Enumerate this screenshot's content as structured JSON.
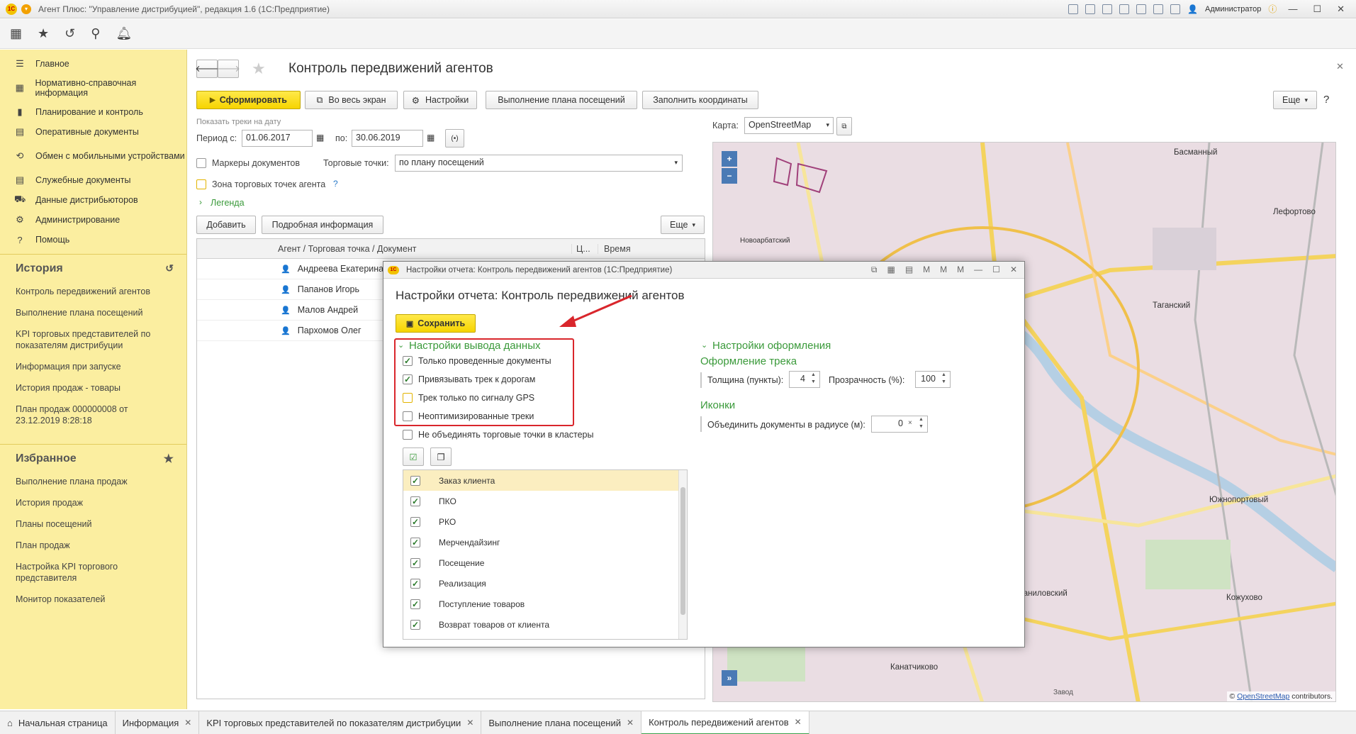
{
  "window": {
    "title": "Агент Плюс: \"Управление дистрибуцией\", редакция 1.6  (1С:Предприятие)",
    "user": "Администратор"
  },
  "sidebar": {
    "nav": [
      {
        "icon": "menu-icon",
        "label": "Главное"
      },
      {
        "icon": "catalog-icon",
        "label": "Нормативно-справочная информация"
      },
      {
        "icon": "chart-icon",
        "label": "Планирование и контроль"
      },
      {
        "icon": "docs-icon",
        "label": "Оперативные документы"
      },
      {
        "icon": "sync-icon",
        "label": "Обмен с мобильными устройствами"
      },
      {
        "icon": "service-docs-icon",
        "label": "Служебные документы"
      },
      {
        "icon": "distributor-icon",
        "label": "Данные дистрибьюторов"
      },
      {
        "icon": "gear-icon",
        "label": "Администрирование"
      },
      {
        "icon": "help-icon",
        "label": "Помощь"
      }
    ],
    "history_title": "История",
    "history": [
      "Контроль передвижений агентов",
      "Выполнение плана посещений",
      "KPI торговых представителей по показателям дистрибуции",
      "Информация при запуске",
      "История продаж - товары",
      "План продаж 000000008 от 23.12.2019 8:28:18"
    ],
    "favorites_title": "Избранное",
    "favorites": [
      "Выполнение плана продаж",
      "История продаж",
      "Планы посещений",
      "План продаж",
      "Настройка KPI торгового представителя",
      "Монитор показателей"
    ]
  },
  "form": {
    "title": "Контроль передвижений агентов",
    "buttons": {
      "generate": "Сформировать",
      "fullscreen": "Во весь экран",
      "settings": "Настройки",
      "visit_plan": "Выполнение плана посещений",
      "fill_coords": "Заполнить координаты",
      "more": "Еще",
      "add": "Добавить",
      "details": "Подробная информация"
    },
    "show_tracks_label": "Показать треки на дату",
    "period_label": "Период с:",
    "period_from": "01.06.2017",
    "period_to_label": "по:",
    "period_to": "30.06.2019",
    "doc_markers_label": "Маркеры документов",
    "trade_points_label": "Торговые точки:",
    "trade_points_value": "по плану посещений",
    "zone_label": "Зона торговых точек агента",
    "legend_label": "Легенда",
    "map_label": "Карта:",
    "map_value": "OpenStreetMap",
    "table": {
      "columns": [
        "Агент / Торговая точка / Документ",
        "Ц...",
        "Время"
      ],
      "rows": [
        "Андреева Екатерина",
        "Папанов Игорь",
        "Малов Андрей",
        "Пархомов Олег"
      ]
    }
  },
  "map": {
    "labels": [
      "Басманный",
      "Лефортово",
      "Таганский",
      "Даниловский",
      "Южнопортовый",
      "Канатчиково",
      "Кожухово",
      "Новоарбатский",
      "Завод"
    ],
    "attribution_prefix": "© ",
    "attribution_link": "OpenStreetMap",
    "attribution_suffix": " contributors."
  },
  "dialog": {
    "window_title": "Настройки отчета: Контроль передвижений агентов  (1С:Предприятие)",
    "heading": "Настройки отчета: Контроль передвижений агентов",
    "save": "Сохранить",
    "output_section": "Настройки вывода данных",
    "options": [
      {
        "label": "Только проведенные документы",
        "checked": true
      },
      {
        "label": "Привязывать трек к дорогам",
        "checked": true
      },
      {
        "label": "Трек только по сигналу GPS",
        "checked": false
      },
      {
        "label": "Неоптимизированные треки",
        "checked": false
      },
      {
        "label": "Не объединять торговые точки в кластеры",
        "checked": false
      }
    ],
    "doc_types": [
      "Заказ клиента",
      "ПКО",
      "РКО",
      "Мерчендайзинг",
      "Посещение",
      "Реализация",
      "Поступление товаров",
      "Возврат товаров от клиента"
    ],
    "design_section": "Настройки оформления",
    "track_section": "Оформление трека",
    "thickness_label": "Толщина (пункты):",
    "thickness_value": "4",
    "transparency_label": "Прозрачность (%):",
    "transparency_value": "100",
    "icons_section": "Иконки",
    "merge_radius_label": "Объединить документы в радиусе (м):",
    "merge_radius_value": "0"
  },
  "tabs": [
    {
      "label": "Начальная страница",
      "closable": false
    },
    {
      "label": "Информация",
      "closable": true
    },
    {
      "label": "KPI торговых представителей по показателям дистрибуции",
      "closable": true
    },
    {
      "label": "Выполнение плана посещений",
      "closable": true
    },
    {
      "label": "Контроль передвижений агентов",
      "closable": true,
      "active": true
    }
  ],
  "colors": {
    "sidebar": "#fbeea0",
    "accent_yellow": "#f6d400",
    "green": "#3a9a3a",
    "highlight_red": "#d9262c"
  }
}
